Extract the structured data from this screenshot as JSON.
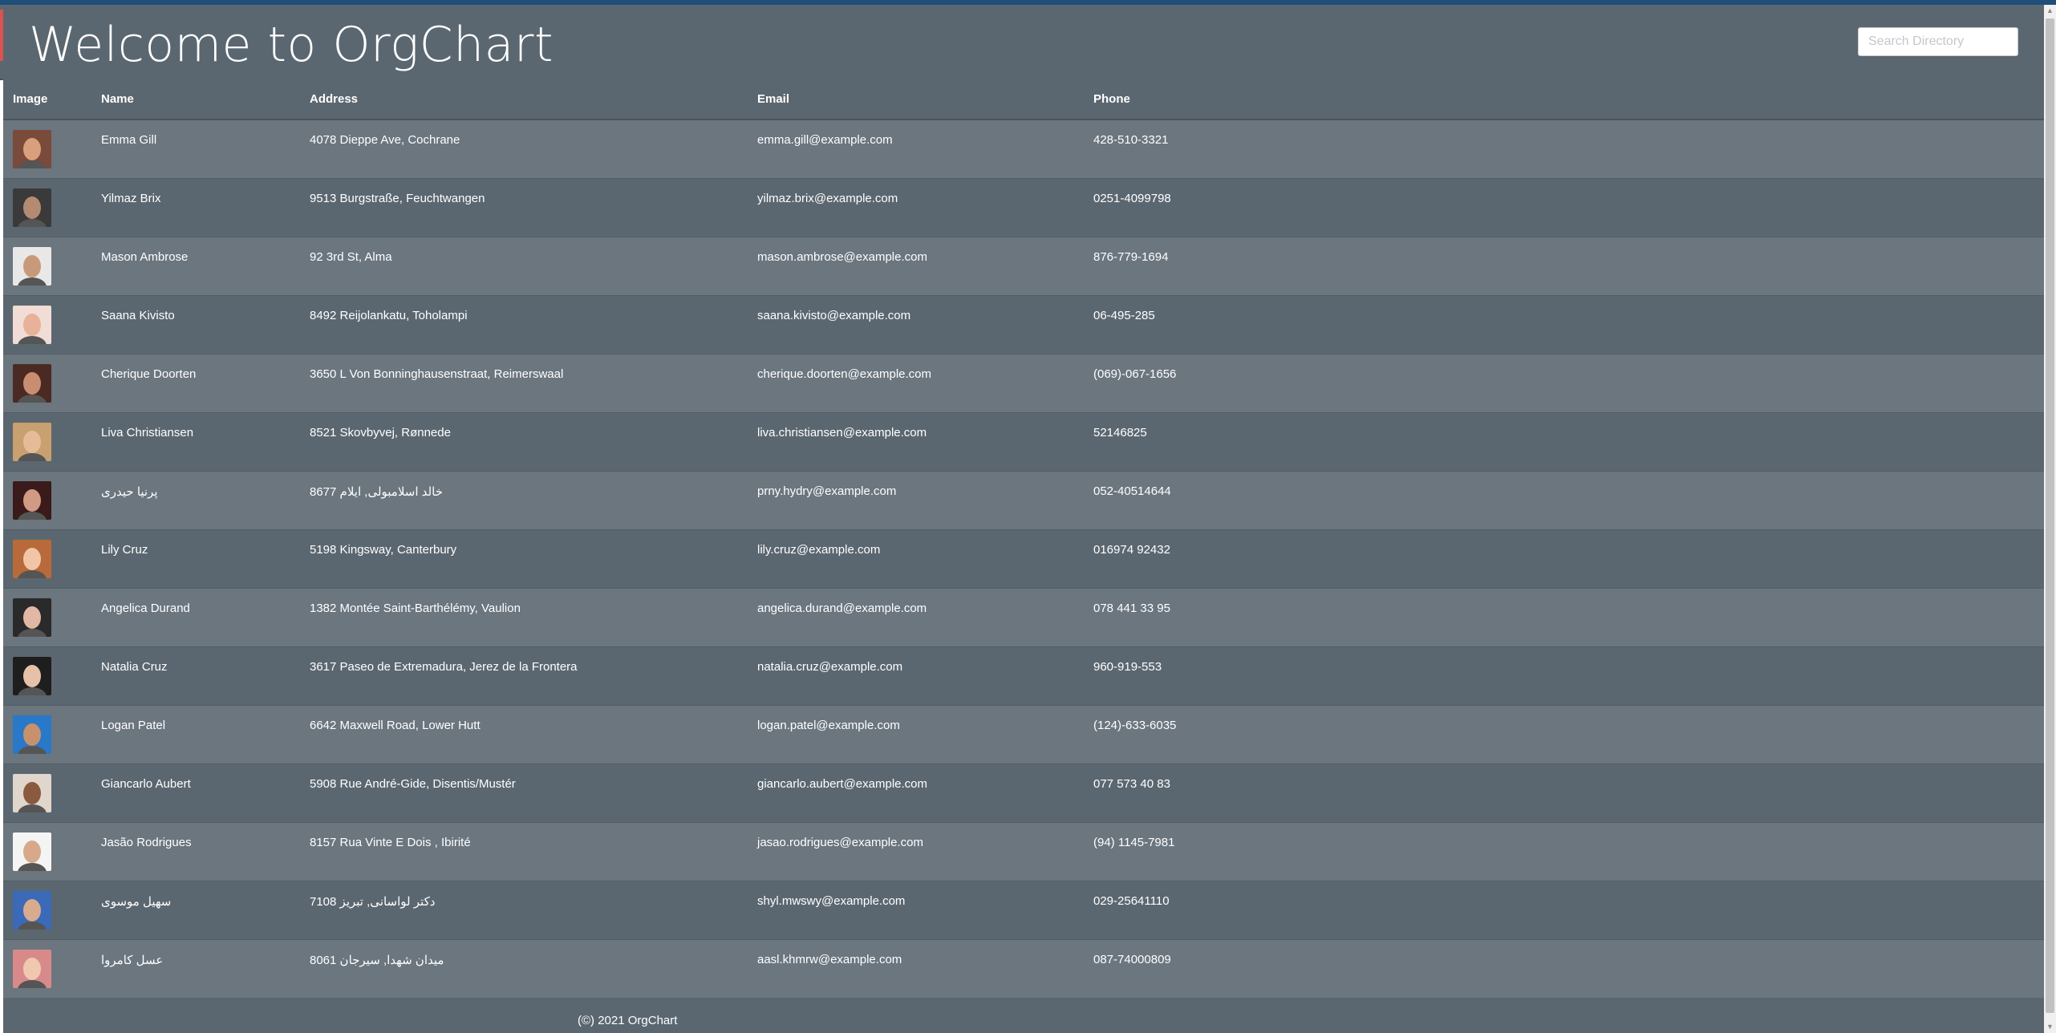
{
  "header": {
    "title": "Welcome to OrgChart",
    "search_placeholder": "Search Directory"
  },
  "table": {
    "columns": [
      "Image",
      "Name",
      "Address",
      "Email",
      "Phone"
    ],
    "rows": [
      {
        "name": "Emma Gill",
        "address": "4078 Dieppe Ave, Cochrane",
        "email": "emma.gill@example.com",
        "phone": "428-510-3321",
        "avatar_color": "#7a4a3a",
        "avatar_skin": "#d9a07d"
      },
      {
        "name": "Yilmaz Brix",
        "address": "9513 Burgstraße, Feuchtwangen",
        "email": "yilmaz.brix@example.com",
        "phone": "0251-4099798",
        "avatar_color": "#3a3a3a",
        "avatar_skin": "#b58a72"
      },
      {
        "name": "Mason Ambrose",
        "address": "92 3rd St, Alma",
        "email": "mason.ambrose@example.com",
        "phone": "876-779-1694",
        "avatar_color": "#e8e8e8",
        "avatar_skin": "#c89a7a"
      },
      {
        "name": "Saana Kivisto",
        "address": "8492 Reijolankatu, Toholampi",
        "email": "saana.kivisto@example.com",
        "phone": "06-495-285",
        "avatar_color": "#f2dcd6",
        "avatar_skin": "#e8b29a"
      },
      {
        "name": "Cherique Doorten",
        "address": "3650 L Von Bonninghausenstraat, Reimerswaal",
        "email": "cherique.doorten@example.com",
        "phone": "(069)-067-1656",
        "avatar_color": "#4a2a22",
        "avatar_skin": "#c98e72"
      },
      {
        "name": "Liva Christiansen",
        "address": "8521 Skovbyvej, Rønnede",
        "email": "liva.christiansen@example.com",
        "phone": "52146825",
        "avatar_color": "#c9a070",
        "avatar_skin": "#e6bb98"
      },
      {
        "name": "پرنیا حیدری",
        "address": "8677 خالد اسلامبولی, ایلام",
        "email": "prny.hydry@example.com",
        "phone": "052-40514644",
        "avatar_color": "#3a1a1a",
        "avatar_skin": "#d09a84"
      },
      {
        "name": "Lily Cruz",
        "address": "5198 Kingsway, Canterbury",
        "email": "lily.cruz@example.com",
        "phone": "016974 92432",
        "avatar_color": "#b86a3a",
        "avatar_skin": "#f0c6a6"
      },
      {
        "name": "Angelica Durand",
        "address": "1382 Montée Saint-Barthélémy, Vaulion",
        "email": "angelica.durand@example.com",
        "phone": "078 441 33 95",
        "avatar_color": "#2a2a2a",
        "avatar_skin": "#e0b8a4"
      },
      {
        "name": "Natalia Cruz",
        "address": "3617 Paseo de Extremadura, Jerez de la Frontera",
        "email": "natalia.cruz@example.com",
        "phone": "960-919-553",
        "avatar_color": "#1e1e1e",
        "avatar_skin": "#e6c0a8"
      },
      {
        "name": "Logan Patel",
        "address": "6642 Maxwell Road, Lower Hutt",
        "email": "logan.patel@example.com",
        "phone": "(124)-633-6035",
        "avatar_color": "#2a78c8",
        "avatar_skin": "#c8916e"
      },
      {
        "name": "Giancarlo Aubert",
        "address": "5908 Rue André-Gide, Disentis/Mustér",
        "email": "giancarlo.aubert@example.com",
        "phone": "077 573 40 83",
        "avatar_color": "#e0d6cc",
        "avatar_skin": "#8a5a3e"
      },
      {
        "name": "Jasão Rodrigues",
        "address": "8157 Rua Vinte E Dois , Ibirité",
        "email": "jasao.rodrigues@example.com",
        "phone": "(94) 1145-7981",
        "avatar_color": "#f4f4f4",
        "avatar_skin": "#d8a88a"
      },
      {
        "name": "سهیل موسوی",
        "address": "7108 دکتر لواسانی, تبریز",
        "email": "shyl.mwswy@example.com",
        "phone": "029-25641110",
        "avatar_color": "#3a6ab8",
        "avatar_skin": "#d8aa8e"
      },
      {
        "name": "عسل کامروا",
        "address": "8061 میدان شهدا, سیرجان",
        "email": "aasl.khmrw@example.com",
        "phone": "087-74000809",
        "avatar_color": "#d88a8a",
        "avatar_skin": "#f0c8b0"
      }
    ]
  },
  "footer": {
    "text": "(©) 2021 OrgChart"
  },
  "colors": {
    "header_bg": "#5b6770",
    "row_odd": "#6b767f",
    "row_even": "#5b6770",
    "top_bar": "#1f4e79"
  }
}
